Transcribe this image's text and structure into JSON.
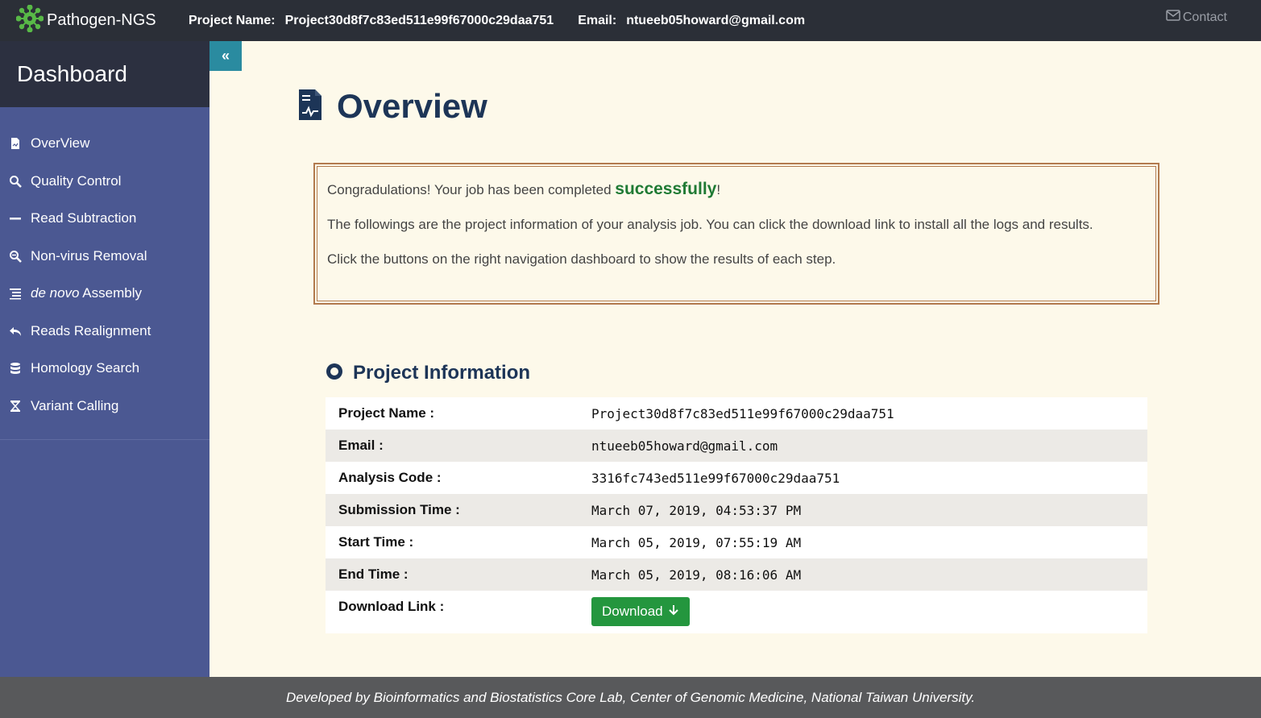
{
  "topbar": {
    "brand": "Pathogen-NGS",
    "project_label": "Project Name:",
    "project_value": "Project30d8f7c83ed511e99f67000c29daa751",
    "email_label": "Email:",
    "email_value": "ntueeb05howard@gmail.com",
    "contact": "Contact",
    "contact_icon": "envelope-icon"
  },
  "sidebar": {
    "title": "Dashboard",
    "items": [
      {
        "label": "OverView",
        "icon": "file-icon"
      },
      {
        "label": "Quality Control",
        "icon": "search-icon"
      },
      {
        "label": "Read Subtraction",
        "icon": "minus-icon"
      },
      {
        "label": "Non-virus Removal",
        "icon": "search-minus-icon"
      },
      {
        "label_italic": "de novo",
        "label": " Assembly",
        "icon": "list-icon"
      },
      {
        "label": "Reads Realignment",
        "icon": "reply-icon"
      },
      {
        "label": "Homology Search",
        "icon": "database-icon"
      },
      {
        "label": "Variant Calling",
        "icon": "hourglass-icon"
      }
    ],
    "collapse": "«"
  },
  "main": {
    "title": "Overview",
    "notice": {
      "line1_before": "Congradulations! Your job has been completed ",
      "line1_highlight": "successfully",
      "line1_after": "!",
      "line2": "The followings are the project information of your analysis job. You can click the download link to install all the logs and results.",
      "line3": "Click the buttons on the right navigation dashboard to show the results of each step."
    },
    "project_info": {
      "heading": "Project Information",
      "rows": [
        {
          "key": "Project Name :",
          "value": "Project30d8f7c83ed511e99f67000c29daa751"
        },
        {
          "key": "Email :",
          "value": "ntueeb05howard@gmail.com"
        },
        {
          "key": "Analysis Code :",
          "value": "3316fc743ed511e99f67000c29daa751"
        },
        {
          "key": "Submission Time :",
          "value": "March 07, 2019, 04:53:37 PM"
        },
        {
          "key": "Start Time :",
          "value": "March 05, 2019, 07:55:19 AM"
        },
        {
          "key": "End Time :",
          "value": "March 05, 2019, 08:16:06 AM"
        }
      ],
      "download_key": "Download Link :",
      "download_label": "Download"
    }
  },
  "footer": "Developed by Bioinformatics and Biostatistics Core Lab, Center of Genomic Medicine, National Taiwan University.",
  "colors": {
    "topbar": "#2b2f37",
    "sidebar": "#4b5892",
    "background": "#fdf9ea",
    "title": "#1d3557",
    "success": "#1f7a34",
    "download": "#24963e",
    "notice_border": "#b27a4e",
    "footer": "#58595b"
  }
}
